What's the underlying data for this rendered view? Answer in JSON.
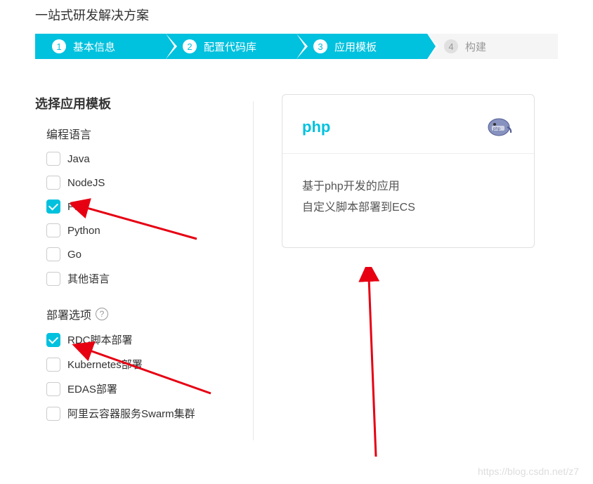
{
  "page_title": "一站式研发解决方案",
  "stepper": {
    "steps": [
      {
        "num": "1",
        "label": "基本信息",
        "active": true
      },
      {
        "num": "2",
        "label": "配置代码库",
        "active": true
      },
      {
        "num": "3",
        "label": "应用模板",
        "active": true
      },
      {
        "num": "4",
        "label": "构建",
        "active": false
      }
    ]
  },
  "section_title": "选择应用模板",
  "language": {
    "label": "编程语言",
    "options": [
      {
        "label": "Java",
        "checked": false
      },
      {
        "label": "NodeJS",
        "checked": false
      },
      {
        "label": "PHP",
        "checked": true
      },
      {
        "label": "Python",
        "checked": false
      },
      {
        "label": "Go",
        "checked": false
      },
      {
        "label": "其他语言",
        "checked": false
      }
    ]
  },
  "deploy": {
    "label": "部署选项",
    "help_symbol": "?",
    "options": [
      {
        "label": "RDC脚本部署",
        "checked": true
      },
      {
        "label": "Kubernetes部署",
        "checked": false
      },
      {
        "label": "EDAS部署",
        "checked": false
      },
      {
        "label": "阿里云容器服务Swarm集群",
        "checked": false
      }
    ]
  },
  "template_card": {
    "title": "php",
    "desc_line1": "基于php开发的应用",
    "desc_line2": "自定义脚本部署到ECS"
  },
  "watermark": "https://blog.csdn.net/z7",
  "colors": {
    "accent": "#00c1de",
    "arrow": "#e60012"
  }
}
